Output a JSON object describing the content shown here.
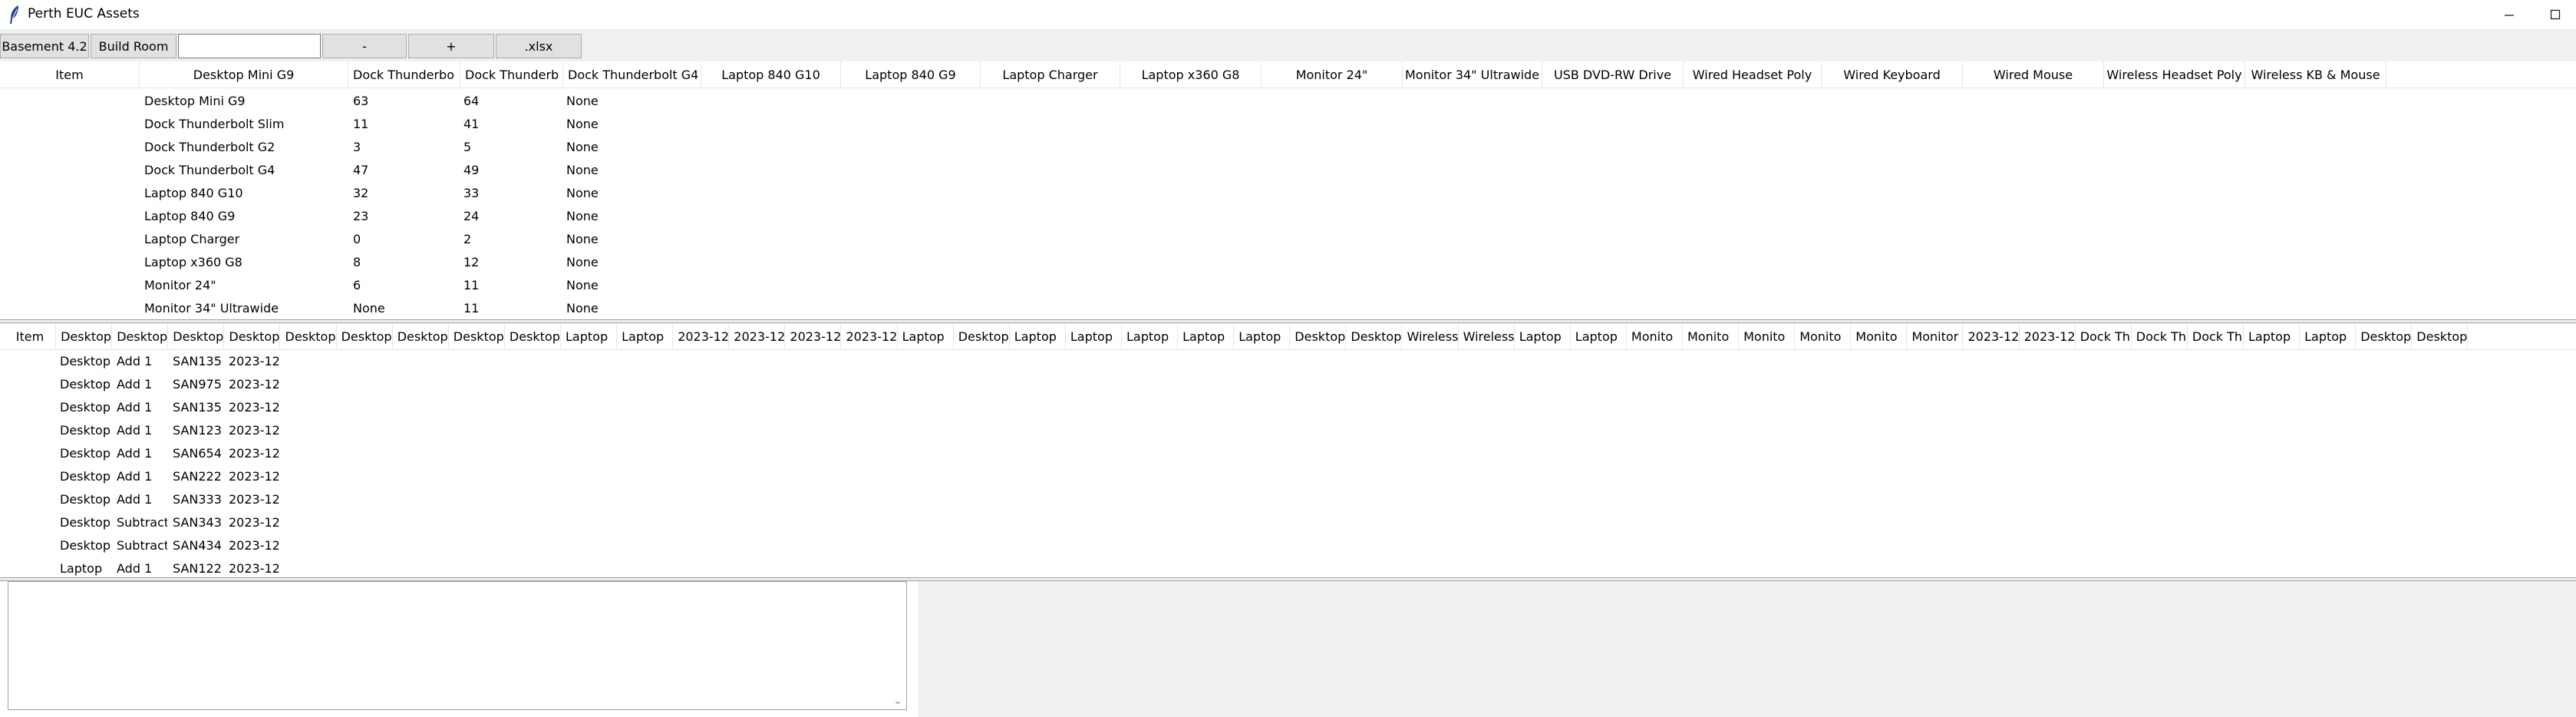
{
  "window": {
    "title": "Perth EUC Assets",
    "minimize_icon": "minimize-icon",
    "maximize_icon": "maximize-icon"
  },
  "toolbar": {
    "basement_label": "Basement 4.2",
    "build_room_label": "Build Room",
    "entry_value": "",
    "minus_label": "-",
    "plus_label": "+",
    "xlsx_label": ".xlsx"
  },
  "summary_table": {
    "headers": [
      "Item",
      "Desktop Mini G9",
      "Dock Thunderbo",
      "Dock Thunderb",
      "Dock Thunderbolt G4",
      "Laptop 840 G10",
      "Laptop 840 G9",
      "Laptop Charger",
      "Laptop x360 G8",
      "Monitor 24\"",
      "Monitor 34\" Ultrawide",
      "USB DVD-RW Drive",
      "Wired Headset Poly",
      "Wired Keyboard",
      "Wired Mouse",
      "Wireless Headset Poly",
      "Wireless KB & Mouse"
    ],
    "rows": [
      [
        "Desktop Mini G9",
        "63",
        "64",
        "None"
      ],
      [
        "Dock Thunderbolt Slim",
        "11",
        "41",
        "None"
      ],
      [
        "Dock Thunderbolt G2",
        "3",
        "5",
        "None"
      ],
      [
        "Dock Thunderbolt G4",
        "47",
        "49",
        "None"
      ],
      [
        "Laptop 840 G10",
        "32",
        "33",
        "None"
      ],
      [
        "Laptop 840 G9",
        "23",
        "24",
        "None"
      ],
      [
        "Laptop Charger",
        "0",
        "2",
        "None"
      ],
      [
        "Laptop x360 G8",
        "8",
        "12",
        "None"
      ],
      [
        "Monitor 24\"",
        "6",
        "11",
        "None"
      ],
      [
        "Monitor 34\" Ultrawide",
        "None",
        "11",
        "None"
      ]
    ]
  },
  "log_table": {
    "headers": [
      "Item",
      "Desktop",
      "Desktop",
      "Desktop",
      "Desktop",
      "Desktop",
      "Desktop",
      "Desktop",
      "Desktop",
      "Desktop",
      "Laptop",
      "Laptop",
      "2023-12",
      "2023-12",
      "2023-12",
      "2023-12",
      "Laptop",
      "Desktop",
      "Laptop",
      "Laptop",
      "Laptop",
      "Laptop",
      "Laptop",
      "Desktop",
      "Desktop",
      "Wireless",
      "Wireless",
      "Laptop",
      "Laptop",
      "Monito",
      "Monito",
      "Monito",
      "Monito",
      "Monito",
      "Monitor",
      "2023-12",
      "2023-12",
      "Dock Th",
      "Dock Th",
      "Dock Th",
      "Laptop",
      "Laptop",
      "Desktop",
      "Desktop"
    ],
    "rows": [
      [
        "Desktop",
        "Add 1",
        "SAN135",
        "2023-12"
      ],
      [
        "Desktop",
        "Add 1",
        "SAN975",
        "2023-12"
      ],
      [
        "Desktop",
        "Add 1",
        "SAN135",
        "2023-12"
      ],
      [
        "Desktop",
        "Add 1",
        "SAN123",
        "2023-12"
      ],
      [
        "Desktop",
        "Add 1",
        "SAN654",
        "2023-12"
      ],
      [
        "Desktop",
        "Add 1",
        "SAN222",
        "2023-12"
      ],
      [
        "Desktop",
        "Add 1",
        "SAN333",
        "2023-12"
      ],
      [
        "Desktop",
        "Subtract",
        "SAN343",
        "2023-12"
      ],
      [
        "Desktop",
        "Subtract",
        "SAN434",
        "2023-12"
      ],
      [
        "Laptop",
        "Add 1",
        "SAN122",
        "2023-12"
      ]
    ]
  },
  "notes": {
    "value": "",
    "scroll_icon": "chevron-down-icon"
  }
}
